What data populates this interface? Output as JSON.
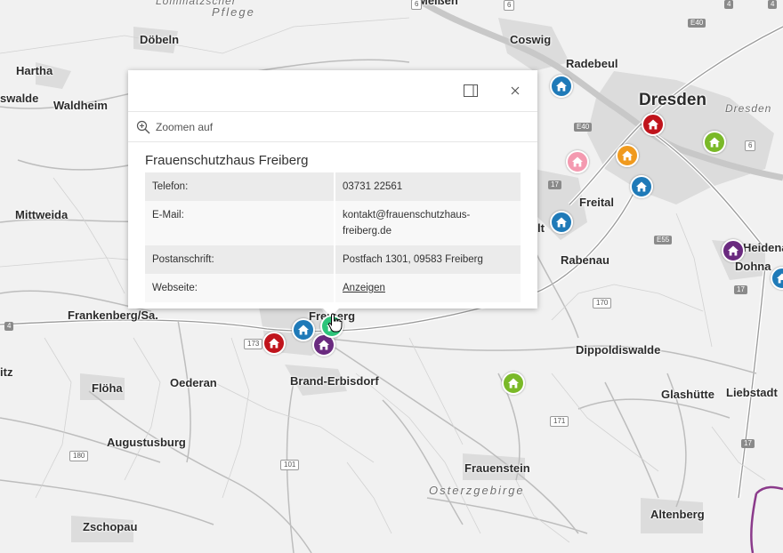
{
  "popup": {
    "zoom_label": "Zoomen auf",
    "title": "Frauenschutzhaus Freiberg",
    "rows": [
      {
        "key": "Telefon:",
        "value": "03731 22561"
      },
      {
        "key": "E-Mail:",
        "value": "kontakt@frauenschutzhaus-\nfreiberg.de"
      },
      {
        "key": "Postanschrift:",
        "value": "Postfach 1301, 09583 Freiberg"
      },
      {
        "key": "Webseite:",
        "value": "Anzeigen"
      }
    ]
  },
  "places": {
    "doebeln": "Döbeln",
    "coswig": "Coswig",
    "hartha": "Hartha",
    "radebeul": "Radebeul",
    "waldheim": "Waldheim",
    "swalde": "swalde",
    "dresden": "Dresden",
    "dresden_region": "Dresden",
    "mittweida": "Mittweida",
    "freital": "Freital",
    "heidenau": "Heidena",
    "dohna": "Dohna",
    "rabenau": "Rabenau",
    "frankenberg": "Frankenberg/Sa.",
    "freiberg": "Freiberg",
    "dippoldiswalde": "Dippoldiswalde",
    "itz": "itz",
    "floeha": "Flöha",
    "oederan": "Oederan",
    "brand_erbisdorf": "Brand-Erbisdorf",
    "glashuette": "Glashütte",
    "liebstadt": "Liebstadt",
    "augustusburg": "Augustusburg",
    "frauenstein": "Frauenstein",
    "osterzgebirge": "Osterzgebirge",
    "altenberg": "Altenberg",
    "zschopau": "Zschopau",
    "pflege": "Pflege",
    "lommatzscher": "Lommatzscher",
    "meissen": "Meißen",
    "lt": "lt"
  },
  "road_shields": [
    "E40",
    "E40",
    "6",
    "6",
    "17",
    "17",
    "E55",
    "170",
    "173",
    "171",
    "180",
    "101",
    "4",
    "4",
    "17",
    "4",
    "6"
  ],
  "markers": [
    {
      "name": "marker-dresden-radebeul",
      "color": "#1f7ab8"
    },
    {
      "name": "marker-dresden-center",
      "color": "#c0141c"
    },
    {
      "name": "marker-dresden-east",
      "color": "#7ab928"
    },
    {
      "name": "marker-dresden-pink",
      "color": "#f49ab0"
    },
    {
      "name": "marker-dresden-orange",
      "color": "#f09a1e"
    },
    {
      "name": "marker-dresden-south",
      "color": "#1f7ab8"
    },
    {
      "name": "marker-freital",
      "color": "#1f7ab8"
    },
    {
      "name": "marker-heidenau",
      "color": "#6a2a7f"
    },
    {
      "name": "marker-freiberg-red",
      "color": "#c0141c"
    },
    {
      "name": "marker-freiberg-blue",
      "color": "#1f7ab8"
    },
    {
      "name": "marker-freiberg-purple",
      "color": "#6a2a7f"
    },
    {
      "name": "marker-freiberg-green-selected",
      "color": "#2dc47a"
    },
    {
      "name": "marker-frauenstein",
      "color": "#7ab928"
    },
    {
      "name": "marker-dohna-edge",
      "color": "#1f7ab8"
    }
  ]
}
